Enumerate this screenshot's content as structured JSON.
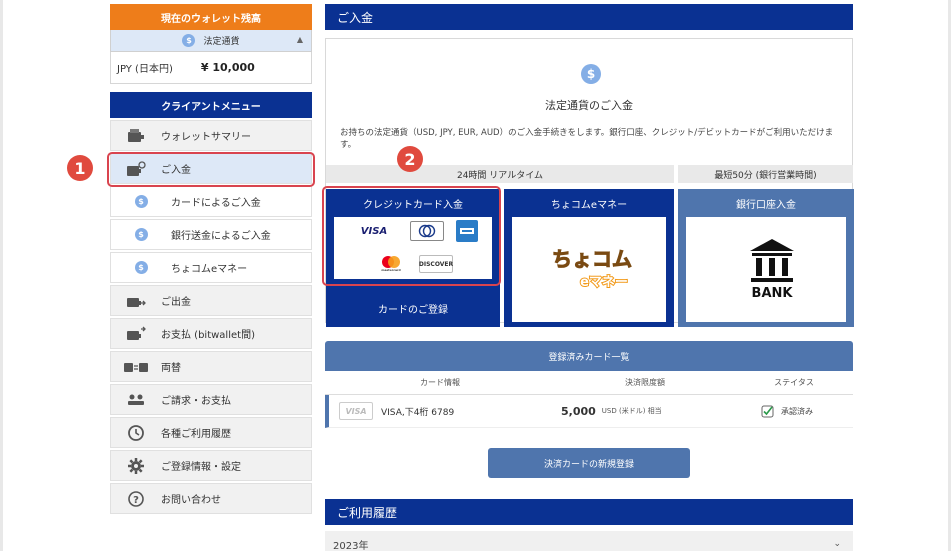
{
  "sidebar": {
    "wallet_title": "現在のウォレット残高",
    "currency_label": "法定通貨",
    "balance_currency": "JPY (日本円)",
    "balance_amount": "¥ 10,000",
    "menu_title": "クライアントメニュー",
    "items": [
      {
        "label": "ウォレットサマリー",
        "icon": "wallet-icon"
      },
      {
        "label": "ご入金",
        "icon": "deposit-icon"
      },
      {
        "label": "カードによるご入金",
        "icon": "dollar-icon"
      },
      {
        "label": "銀行送金によるご入金",
        "icon": "dollar-icon"
      },
      {
        "label": "ちょコムeマネー",
        "icon": "dollar-icon"
      },
      {
        "label": "ご出金",
        "icon": "withdraw-icon"
      },
      {
        "label": "お支払 (bitwallet間)",
        "icon": "payment-icon"
      },
      {
        "label": "両替",
        "icon": "exchange-icon"
      },
      {
        "label": "ご請求・お支払",
        "icon": "users-icon"
      },
      {
        "label": "各種ご利用履歴",
        "icon": "history-icon"
      },
      {
        "label": "ご登録情報・設定",
        "icon": "gear-icon"
      },
      {
        "label": "お問い合わせ",
        "icon": "question-icon"
      }
    ]
  },
  "steps": {
    "one": "1",
    "two": "2"
  },
  "deposit": {
    "section_title": "ご入金",
    "heading": "法定通貨のご入金",
    "description": "お持ちの法定通貨（USD, JPY, EUR, AUD）のご入金手続きをします。銀行口座、クレジット/デビットカードがご利用いただけます。",
    "band_realtime": "24時間 リアルタイム",
    "band_bank": "最短50分 (銀行営業時間)",
    "credit_title": "クレジットカード入金",
    "choco_title": "ちょコムeマネー",
    "bank_title": "銀行口座入金",
    "card_register": "カードのご登録",
    "logos": {
      "visa": "VISA",
      "discover": "DISCOVER",
      "mastercard": "mastercard"
    },
    "choco_logo_top": "ちょコム",
    "choco_logo_bottom": "eマネー",
    "bank_logo": "BANK"
  },
  "registered": {
    "title": "登録済みカード一覧",
    "col_info": "カード情報",
    "col_limit": "決済限度額",
    "col_status": "ステイタス",
    "row": {
      "brand": "VISA",
      "info": "VISA,下4桁 6789",
      "amount": "5,000",
      "unit": "USD (米ドル) 相当",
      "status": "承認済み"
    },
    "new_button": "決済カードの新規登録"
  },
  "history": {
    "title": "ご利用履歴",
    "year": "2023年"
  },
  "colors": {
    "navy": "#0a3192",
    "orange": "#ee7d1a",
    "steel": "#4f75ad",
    "highlight": "#d9444f"
  }
}
